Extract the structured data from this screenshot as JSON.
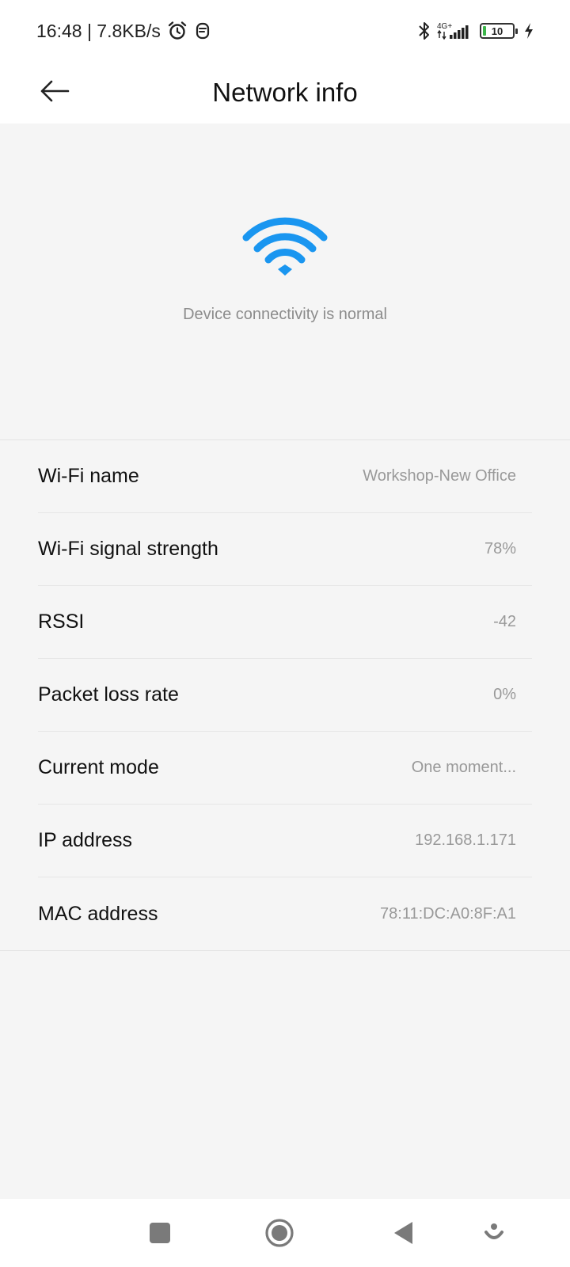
{
  "status_bar": {
    "time_speed": "16:48 | 7.8KB/s",
    "network_type": "4G+",
    "battery_level": "10"
  },
  "header": {
    "title": "Network info"
  },
  "hero": {
    "status_text": "Device connectivity is normal",
    "accent_color": "#1a96f0"
  },
  "info": {
    "rows": [
      {
        "label": "Wi-Fi name",
        "value": "Workshop-New Office"
      },
      {
        "label": "Wi-Fi signal strength",
        "value": "78%"
      },
      {
        "label": "RSSI",
        "value": "-42"
      },
      {
        "label": "Packet loss rate",
        "value": "0%"
      },
      {
        "label": "Current mode",
        "value": "One moment..."
      },
      {
        "label": "IP address",
        "value": "192.168.1.171"
      },
      {
        "label": "MAC address",
        "value": "78:11:DC:A0:8F:A1"
      }
    ]
  }
}
